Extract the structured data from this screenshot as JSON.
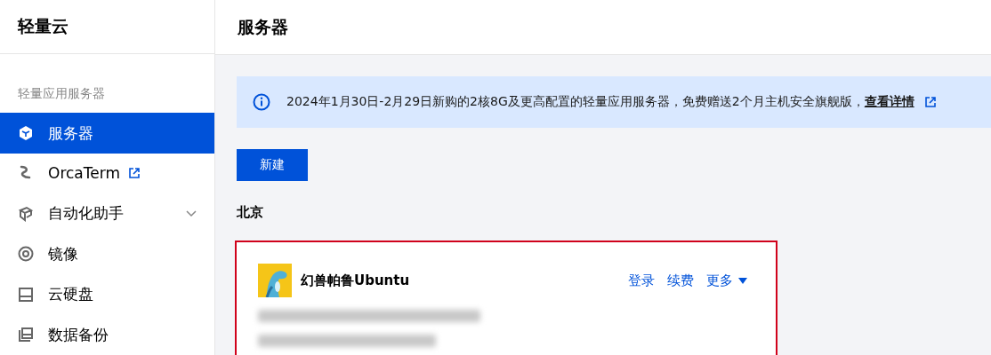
{
  "sidebar": {
    "title": "轻量云",
    "section": "轻量应用服务器",
    "items": [
      {
        "label": "服务器",
        "kind": "cube",
        "selected": true
      },
      {
        "label": "OrcaTerm",
        "kind": "orca",
        "selected": false,
        "external": true
      },
      {
        "label": "自动化助手",
        "kind": "tool",
        "selected": false,
        "expandable": true
      },
      {
        "label": "镜像",
        "kind": "disc",
        "selected": false
      },
      {
        "label": "云硬盘",
        "kind": "disk",
        "selected": false
      },
      {
        "label": "数据备份",
        "kind": "backup",
        "selected": false
      }
    ]
  },
  "header": {
    "title": "服务器"
  },
  "notice": {
    "text": "2024年1月30日-2月29日新购的2核8G及更高配置的轻量应用服务器，免费赠送2个月主机安全旗舰版，",
    "link": "查看详情"
  },
  "new_button": "新建",
  "region": "北京",
  "instance": {
    "name": "幻兽帕鲁Ubuntu",
    "actions": [
      "登录",
      "续费",
      "更多"
    ],
    "highlighted": true
  }
}
